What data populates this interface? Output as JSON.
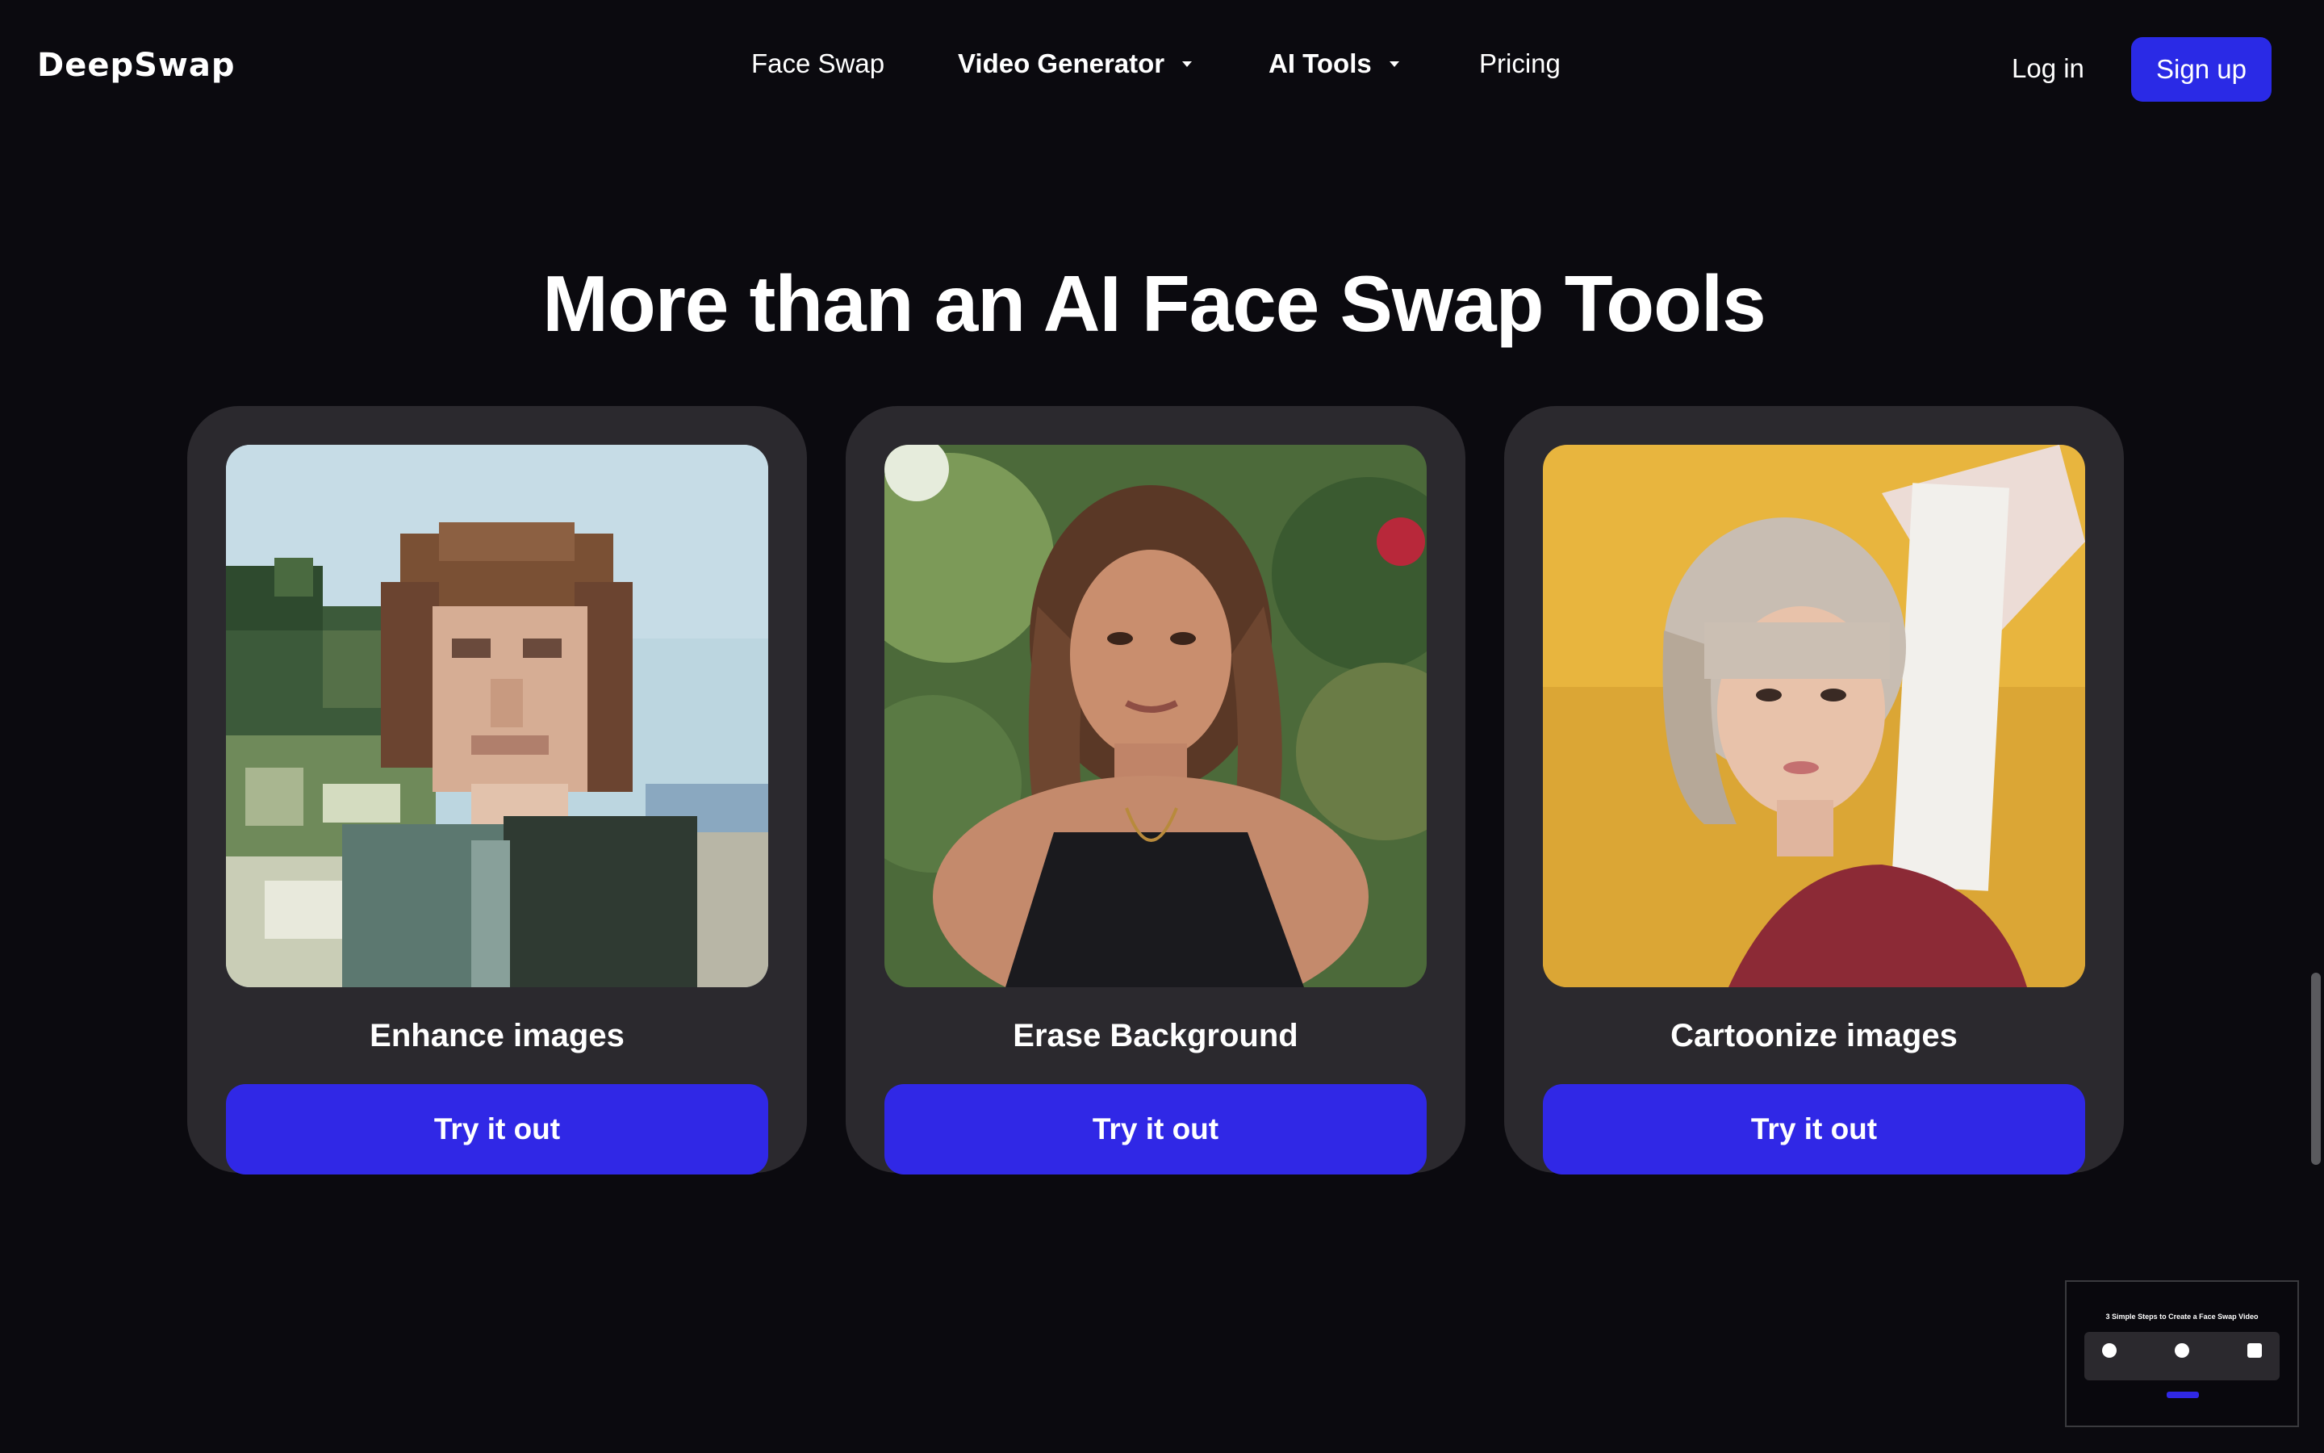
{
  "header": {
    "logo": "DeepSwap",
    "nav": [
      {
        "label": "Face Swap",
        "has_dropdown": false
      },
      {
        "label": "Video Generator",
        "has_dropdown": true
      },
      {
        "label": "AI Tools",
        "has_dropdown": true
      },
      {
        "label": "Pricing",
        "has_dropdown": false
      }
    ],
    "login_label": "Log in",
    "signup_label": "Sign up"
  },
  "main": {
    "heading": "More than an AI Face Swap Tools",
    "cards": [
      {
        "title": "Enhance images",
        "button": "Try it out",
        "image_icon": "pixelated-portrait-image"
      },
      {
        "title": "Erase Background",
        "button": "Try it out",
        "image_icon": "woman-portrait-image"
      },
      {
        "title": "Cartoonize images",
        "button": "Try it out",
        "image_icon": "woman-yellow-background-image"
      }
    ]
  },
  "minimap": {
    "title": "3 Simple Steps to Create a Face Swap Video"
  },
  "colors": {
    "background": "#0b0a0f",
    "card": "#2b292e",
    "button": "#3028e6",
    "signup": "#2a2ae6"
  }
}
